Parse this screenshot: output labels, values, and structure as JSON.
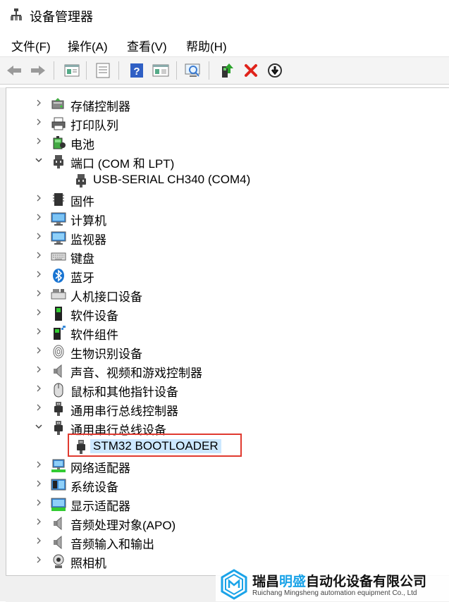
{
  "window": {
    "title": "设备管理器"
  },
  "menu": [
    "文件(F)",
    "操作(A)",
    "查看(V)",
    "帮助(H)"
  ],
  "toolbar": {
    "buttons": [
      "back-icon",
      "forward-icon",
      "properties-icon",
      "list-icon",
      "help-icon",
      "view-icon",
      "scan-icon",
      "update-driver-icon",
      "uninstall-icon",
      "disable-icon"
    ]
  },
  "tree": {
    "items": [
      {
        "label": "存储控制器",
        "icon": "storage-icon",
        "expander": "collapsed"
      },
      {
        "label": "打印队列",
        "icon": "printer-icon",
        "expander": "collapsed"
      },
      {
        "label": "电池",
        "icon": "battery-icon",
        "expander": "collapsed"
      },
      {
        "label": "端口 (COM 和 LPT)",
        "icon": "port-icon",
        "expander": "expanded"
      },
      {
        "label": "USB-SERIAL CH340 (COM4)",
        "icon": "port-icon",
        "expander": "none",
        "child": true
      },
      {
        "label": "固件",
        "icon": "firmware-icon",
        "expander": "collapsed"
      },
      {
        "label": "计算机",
        "icon": "computer-icon",
        "expander": "collapsed"
      },
      {
        "label": "监视器",
        "icon": "monitor-icon",
        "expander": "collapsed"
      },
      {
        "label": "键盘",
        "icon": "keyboard-icon",
        "expander": "collapsed"
      },
      {
        "label": "蓝牙",
        "icon": "bluetooth-icon",
        "expander": "collapsed"
      },
      {
        "label": "人机接口设备",
        "icon": "hid-icon",
        "expander": "collapsed"
      },
      {
        "label": "软件设备",
        "icon": "software-device-icon",
        "expander": "collapsed"
      },
      {
        "label": "软件组件",
        "icon": "software-component-icon",
        "expander": "collapsed"
      },
      {
        "label": "生物识别设备",
        "icon": "fingerprint-icon",
        "expander": "collapsed"
      },
      {
        "label": "声音、视频和游戏控制器",
        "icon": "speaker-icon",
        "expander": "collapsed"
      },
      {
        "label": "鼠标和其他指针设备",
        "icon": "mouse-icon",
        "expander": "collapsed"
      },
      {
        "label": "通用串行总线控制器",
        "icon": "usb-icon",
        "expander": "collapsed"
      },
      {
        "label": "通用串行总线设备",
        "icon": "usb-icon",
        "expander": "expanded"
      },
      {
        "label": "STM32  BOOTLOADER",
        "icon": "usb-icon",
        "expander": "none",
        "child": true,
        "selected": true
      },
      {
        "label": "网络适配器",
        "icon": "network-icon",
        "expander": "collapsed"
      },
      {
        "label": "系统设备",
        "icon": "system-icon",
        "expander": "collapsed"
      },
      {
        "label": "显示适配器",
        "icon": "display-adapter-icon",
        "expander": "collapsed"
      },
      {
        "label": "音频处理对象(APO)",
        "icon": "speaker-icon",
        "expander": "collapsed"
      },
      {
        "label": "音频输入和输出",
        "icon": "speaker-icon",
        "expander": "collapsed"
      },
      {
        "label": "照相机",
        "icon": "camera-icon",
        "expander": "collapsed"
      }
    ]
  },
  "watermark": {
    "company_prefix": "瑞昌",
    "company_brand": "明盛",
    "company_suffix": "自动化设备有限公司",
    "company_en": "Ruichang Mingsheng automation equipment Co., Ltd"
  },
  "colors": {
    "selection": "#cce8ff",
    "highlight_border": "#e03a2f",
    "brand": "#1aa3e8"
  }
}
